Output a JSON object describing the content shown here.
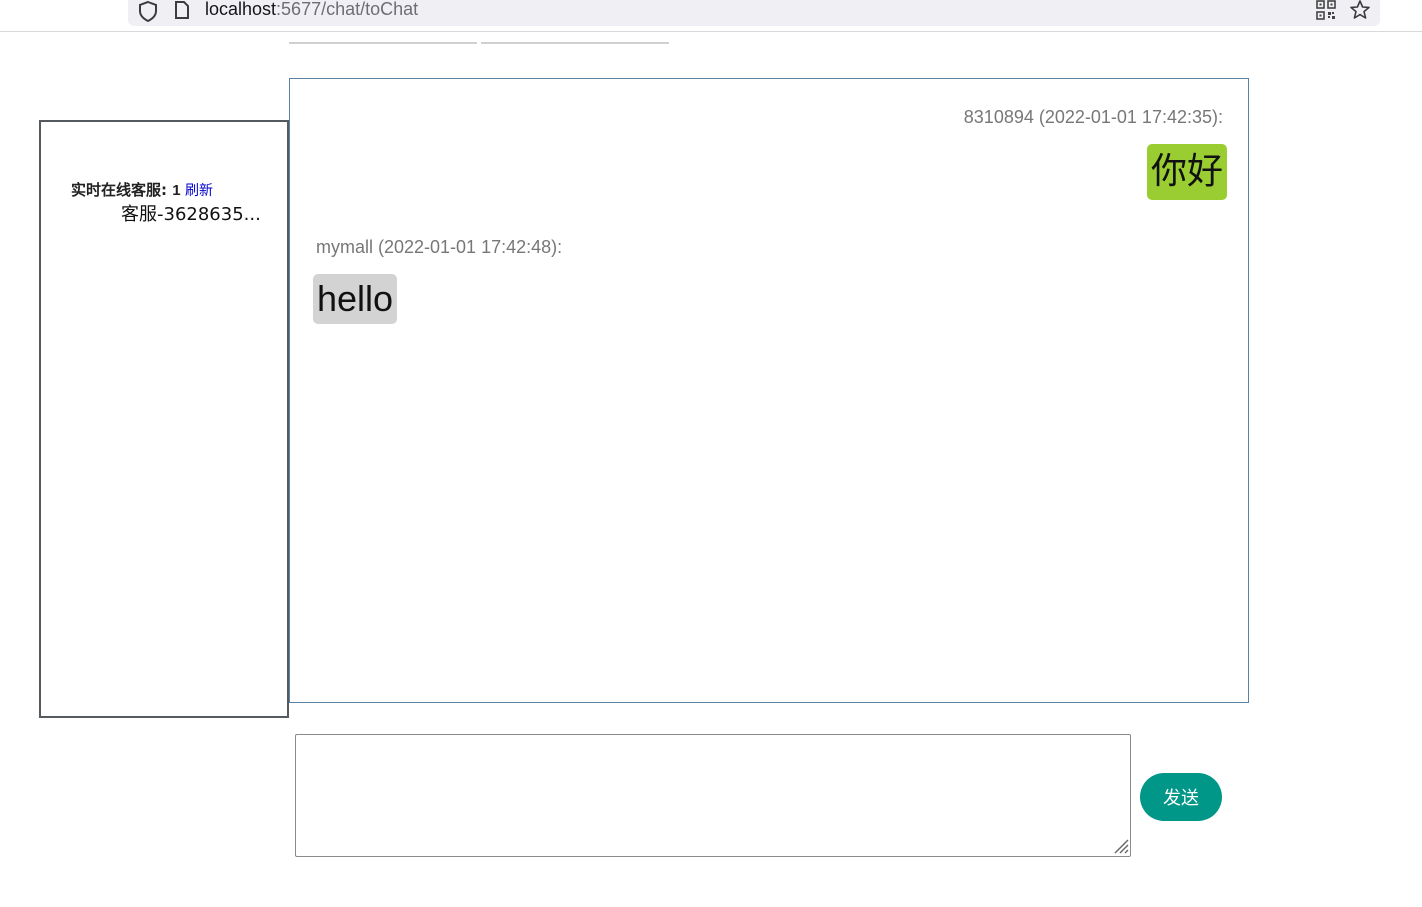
{
  "browser": {
    "url_host": "localhost",
    "url_path": ":5677/chat/toChat"
  },
  "online_panel": {
    "title": "实时在线客服: ",
    "count": "1",
    "refresh_label": "刷新",
    "agents": [
      "客服-3628635..."
    ]
  },
  "messages": [
    {
      "sender": "8310894",
      "time": "2022-01-01 17:42:35",
      "meta": "8310894 (2022-01-01 17:42:35):",
      "text": "你好",
      "side": "right"
    },
    {
      "sender": "mymall",
      "time": "2022-01-01 17:42:48",
      "meta": "mymall (2022-01-01 17:42:48):",
      "text": "hello",
      "side": "left"
    }
  ],
  "composer": {
    "value": "",
    "send_label": "发送"
  },
  "colors": {
    "outgoing_bubble": "#9acd32",
    "incoming_bubble": "#d3d3d3",
    "send_button": "#009688",
    "chat_border": "#5b82a3"
  }
}
